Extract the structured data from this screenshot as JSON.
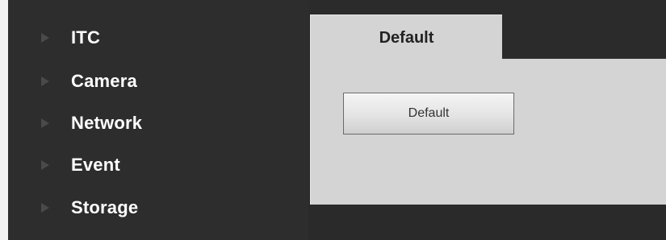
{
  "sidebar": {
    "items": [
      {
        "label": "ITC",
        "icon": "triangle-right-icon"
      },
      {
        "label": "Camera",
        "icon": "triangle-right-icon"
      },
      {
        "label": "Network",
        "icon": "triangle-right-icon"
      },
      {
        "label": "Event",
        "icon": "triangle-right-icon"
      },
      {
        "label": "Storage",
        "icon": "triangle-right-icon"
      }
    ]
  },
  "main": {
    "tabs": [
      {
        "label": "Default",
        "active": true
      }
    ],
    "panel": {
      "default_button_label": "Default"
    }
  },
  "colors": {
    "sidebar_bg": "#2d2d2d",
    "panel_bg": "#d4d4d4",
    "nav_text": "#ffffff",
    "arrow": "#4a4a4a"
  }
}
